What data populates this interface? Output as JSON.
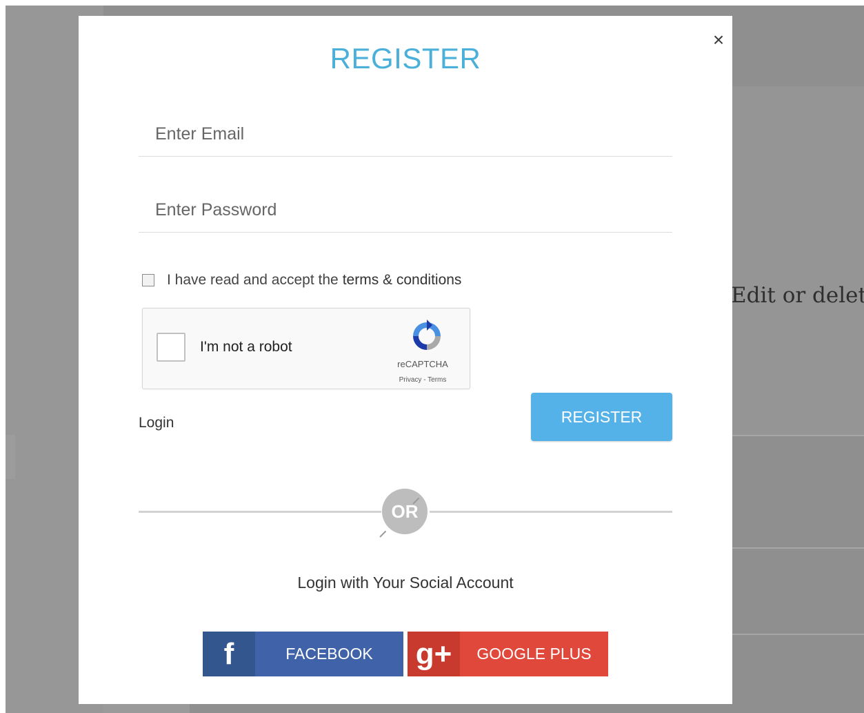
{
  "background": {
    "text": "Edit or delete"
  },
  "modal": {
    "close_icon": "×",
    "title": "REGISTER",
    "email": {
      "placeholder": "Enter Email",
      "value": ""
    },
    "password": {
      "placeholder": "Enter Password",
      "value": ""
    },
    "terms": {
      "prefix": "I have read and accept the",
      "link": "terms & conditions",
      "checked": false
    },
    "recaptcha": {
      "label": "I'm not a robot",
      "brand": "reCAPTCHA",
      "links": "Privacy - Terms"
    },
    "login_link": "Login",
    "register_button": "REGISTER",
    "divider_text": "OR",
    "social_heading": "Login with Your Social Account",
    "facebook": {
      "icon_glyph": "f",
      "label": "FACEBOOK"
    },
    "google": {
      "icon_glyph": "g+",
      "label": "GOOGLE PLUS"
    }
  },
  "colors": {
    "accent": "#4ab0d9",
    "register_button": "#55b2e8",
    "facebook": "#3f62a8",
    "google": "#e0483b",
    "backdrop": "#8f8f8f"
  },
  "icons": [
    "close-icon",
    "checkbox-icon",
    "recaptcha-logo-icon",
    "facebook-icon",
    "google-plus-icon"
  ]
}
